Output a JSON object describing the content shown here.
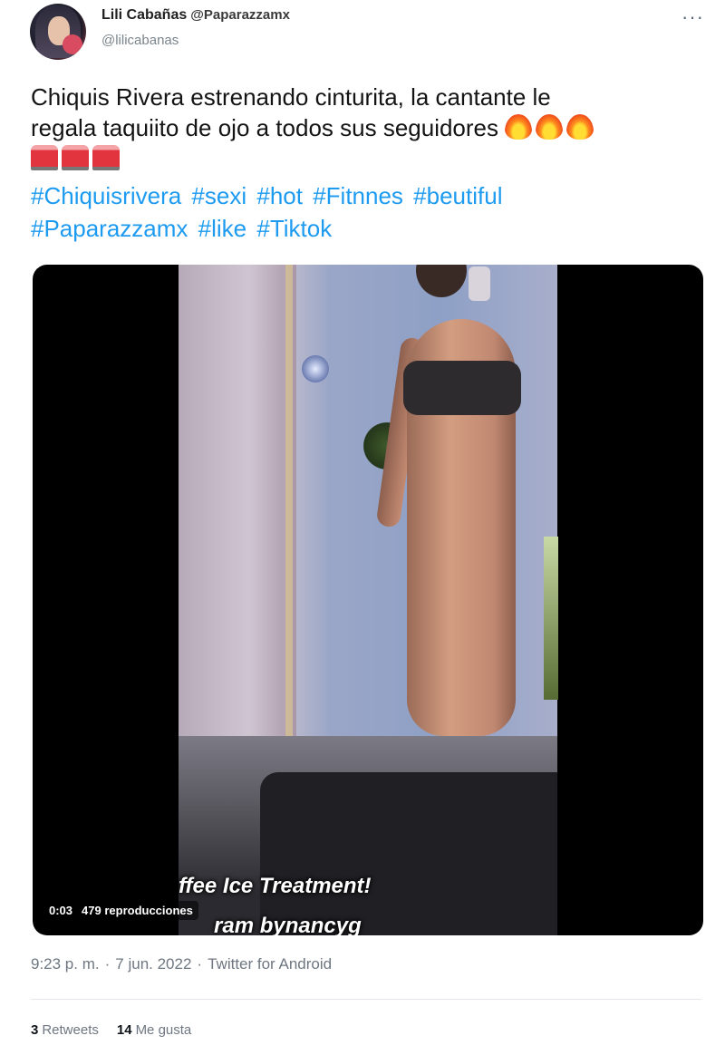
{
  "author": {
    "display_name": "Lili Cabañas",
    "name_handle": "@Paparazzamx",
    "handle": "@lilicabanas"
  },
  "tweet": {
    "text_line1": "Chiquis Rivera estrenando cinturita, la cantante le",
    "text_line2": "regala taquiito de ojo a todos sus seguidores",
    "emojis_fire": [
      "fire",
      "fire",
      "fire"
    ],
    "emojis_siren": [
      "rotating-light",
      "rotating-light",
      "rotating-light"
    ],
    "hashtags": [
      "#Chiquisrivera",
      "#sexi",
      "#hot",
      "#Fitnnes",
      "#beutiful",
      "#Paparazzamx",
      "#like",
      "#Tiktok"
    ]
  },
  "video": {
    "caption_line1": "ffee Ice Treatment!",
    "caption_line2": "ram  bynancyg",
    "time": "0:03",
    "views": "479 reproducciones"
  },
  "meta": {
    "time": "9:23 p. m.",
    "separator": "·",
    "date": "7 jun. 2022",
    "source": "Twitter for Android"
  },
  "stats": {
    "retweets_count": "3",
    "retweets_label": "Retweets",
    "likes_count": "14",
    "likes_label": "Me gusta"
  },
  "colors": {
    "link": "#1d9bf0",
    "secondary_text": "#6e7781"
  },
  "icons": {
    "more": "more-horizontal-icon"
  }
}
